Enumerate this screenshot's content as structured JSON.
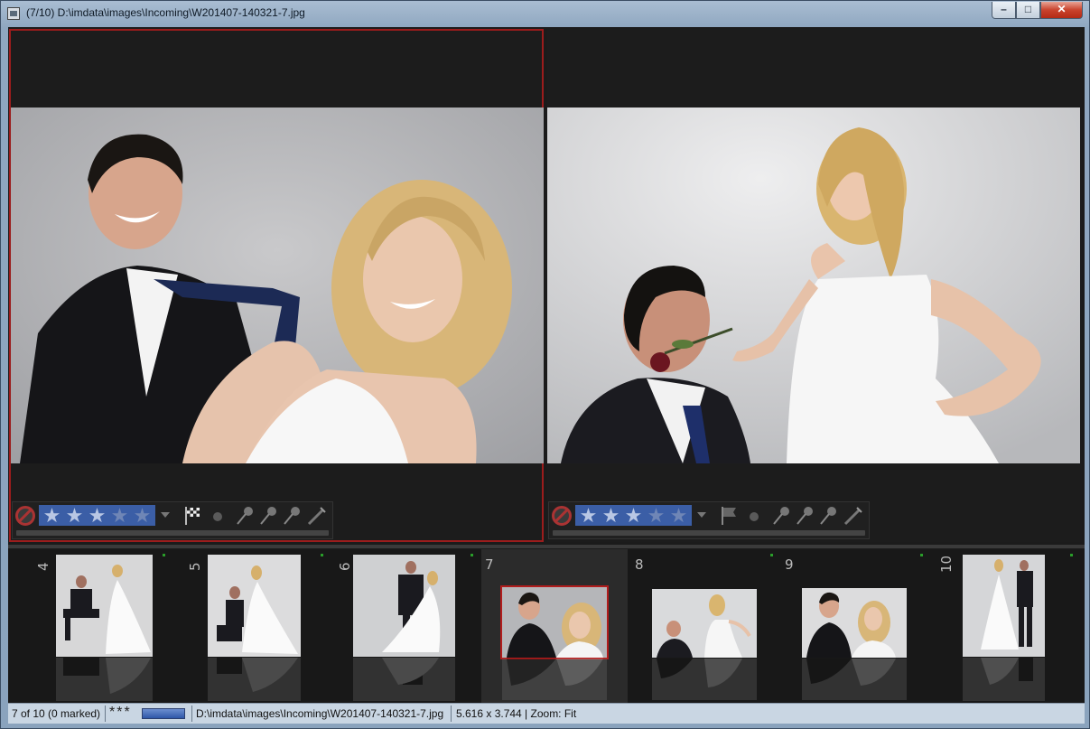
{
  "window": {
    "title": "(7/10) D:\\imdata\\images\\Incoming\\W201407-140321-7.jpg",
    "controls": {
      "minimize": "–",
      "maximize": "□",
      "close": "✕"
    }
  },
  "panes": [
    {
      "id": "left",
      "selected": true,
      "rating": 3,
      "flag_icon": "checkered-flag-icon"
    },
    {
      "id": "right",
      "selected": false,
      "rating": 3,
      "flag_icon": "flag-icon"
    }
  ],
  "filmstrip": {
    "items": [
      {
        "number": "4",
        "current": false
      },
      {
        "number": "5",
        "current": false
      },
      {
        "number": "6",
        "current": false
      },
      {
        "number": "7",
        "current": true
      },
      {
        "number": "8",
        "current": false
      },
      {
        "number": "9",
        "current": false
      },
      {
        "number": "10",
        "current": false
      }
    ]
  },
  "status": {
    "position": "7 of 10 (0 marked)",
    "rating_stars": "***",
    "path": "D:\\imdata\\images\\Incoming\\W201407-140321-7.jpg",
    "info": "5.616 x 3.744 | Zoom: Fit"
  },
  "colors": {
    "selection": "#9b1c1c",
    "rating_fill": "#3b5ea6",
    "status_green": "#2a9d2a"
  }
}
